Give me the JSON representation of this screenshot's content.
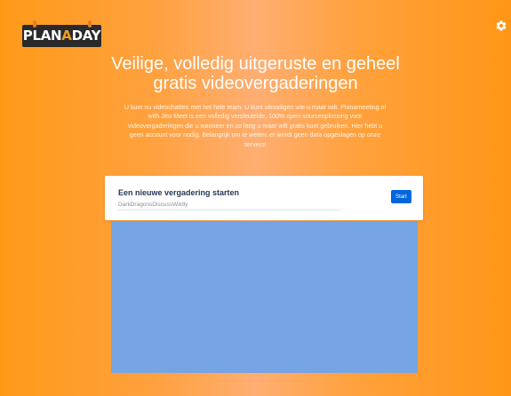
{
  "brand": {
    "logo_prefix": "PLAN",
    "logo_highlight": "A",
    "logo_suffix": "DAY",
    "logo_text_color": "#FFFFFF",
    "logo_highlight_color": "#F39C1F",
    "logo_bg_color": "#2A2A2A"
  },
  "header": {
    "settings_icon": "gear-icon"
  },
  "hero": {
    "title": "Veilige, volledig uitgeruste en geheel gratis videovergaderingen",
    "description": "U kunt nu videochatten met het hele team. U kunt uitnodigen wie u maar wilt. Planameeting.nl with Jitsi Meet is een volledig versleutelde, 100% open-sourceoplossing voor videovergaderingen die u wanneer en zo lang u maar wilt gratis kunt gebruiken. Hier hebt u geen account voor nodig. Belangrijk om te weten: er wordt geen data opgeslagen op onze servers!"
  },
  "meeting": {
    "title": "Een nieuwe vergadering starten",
    "room_placeholder": "DarkDragonsDiscussWildly",
    "start_label": "Start"
  },
  "colors": {
    "background_primary": "#FF9A18",
    "background_center": "#FFAE72",
    "button": "#0066DD",
    "preview_panel": "#76A4E4"
  }
}
